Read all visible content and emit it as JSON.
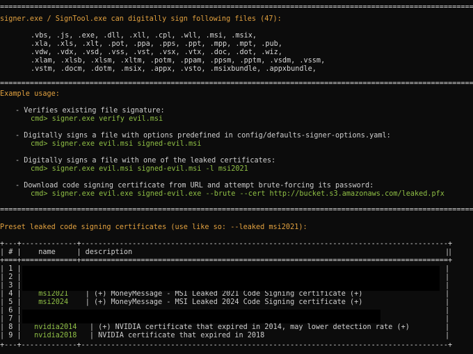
{
  "header": {
    "signer_line": "signer.exe / SignTool.exe can digitally sign following files (47):",
    "extensions": [
      ".vbs, .js, .exe, .dll, .xll, .cpl, .wll, .msi, .msix,",
      ".xla, .xls, .xlt, .pot, .ppa, .pps, .ppt, .mpp, .mpt, .pub,",
      ".vdw, .vdx, .vsd, .vss, .vst, .vsx, .vtx, .doc, .dot, .wiz,",
      ".xlam, .xlsb, .xlsm, .xltm, .potm, .ppam, .ppsm, .pptm, .vsdm, .vssm,",
      ".vstm, .docm, .dotm, .msix, .appx, .vsto, .msixbundle, .appxbundle,"
    ]
  },
  "usage": {
    "title": "Example usage:",
    "items": [
      {
        "desc": "- Verifies existing file signature:",
        "cmd_prefix": "cmd> ",
        "cmd": "signer.exe verify evil.msi"
      },
      {
        "desc": "- Digitally signs a file with options predefined in config/defaults-signer-options.yaml:",
        "cmd_prefix": "cmd> ",
        "cmd": "signer.exe evil.msi signed-evil.msi"
      },
      {
        "desc": "- Digitally signs a file with one of the leaked certificates:",
        "cmd_prefix": "cmd> ",
        "cmd": "signer.exe evil.msi signed-evil.msi -l msi2021"
      },
      {
        "desc": "- Download code signing certificate from URL and attempt brute-forcing its password:",
        "cmd_prefix": "cmd> ",
        "cmd": "signer.exe evil.exe signed-evil.exe --brute --cert http://bucket.s3.amazonaws.com/leaked.pfx"
      }
    ]
  },
  "preset": {
    "title": "Preset leaked code signing certificates (use like so: --leaked msi2021):",
    "border_top": "+---+-------------+--------------------------------------------------------------------------------------+",
    "header_row": "| # |    name     | description                                                                          |",
    "border_mid": "+===+=============+======================================================================================+",
    "rows": [
      {
        "num": "1",
        "name": "",
        "desc": ""
      },
      {
        "num": "2",
        "name": "",
        "desc": ""
      },
      {
        "num": "3",
        "name": "",
        "desc": ""
      },
      {
        "num": "4",
        "name": "msi2021",
        "desc": "(+) MoneyMessage - MSI Leaked 2021 Code Signing certificate (+)"
      },
      {
        "num": "5",
        "name": "msi2024",
        "desc": "(+) MoneyMessage - MSI Leaked 2024 Code Signing certificate (+)"
      },
      {
        "num": "6",
        "name": "",
        "desc": ""
      },
      {
        "num": "7",
        "name": "",
        "desc": ""
      },
      {
        "num": "8",
        "name": "nvidia2014",
        "desc": "(+) NVIDIA certificate that expired in 2014, may lower detection rate (+)"
      },
      {
        "num": "9",
        "name": "nvidia2018",
        "desc": "NVIDIA certificate that expired in 2018"
      }
    ]
  },
  "colors": {
    "background": "#0c0c0c",
    "text": "#cfcfcf",
    "orange": "#e2a13f",
    "green": "#8fbf45"
  }
}
